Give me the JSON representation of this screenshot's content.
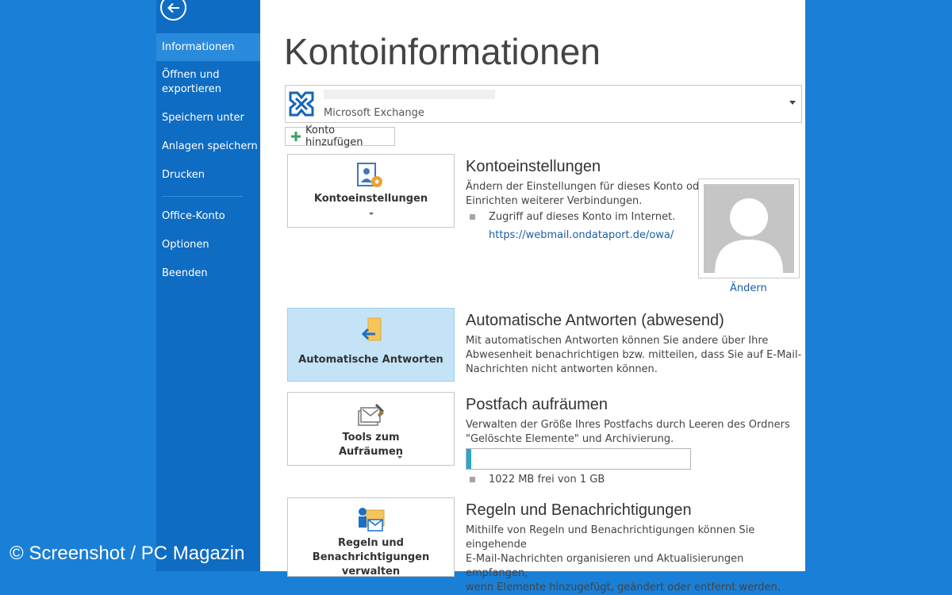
{
  "sidebar": {
    "back_icon": "back-arrow-icon",
    "items": [
      {
        "label": "Informationen",
        "active": true
      },
      {
        "label": "Öffnen und exportieren"
      },
      {
        "label": "Speichern unter"
      },
      {
        "label": "Anlagen speichern"
      },
      {
        "label": "Drucken"
      },
      {
        "label": "Office-Konto"
      },
      {
        "label": "Optionen"
      },
      {
        "label": "Beenden"
      }
    ]
  },
  "main": {
    "title": "Kontoinformationen",
    "account": {
      "type": "Microsoft Exchange",
      "icon": "exchange-icon"
    },
    "add_account_label": "Konto hinzufügen",
    "sections": {
      "account_settings": {
        "tile_label": "Kontoeinstellungen",
        "title": "Kontoeinstellungen",
        "description": "Ändern der Einstellungen für dieses Konto oder\nEinrichten weiterer Verbindungen.",
        "bullet": "Zugriff auf dieses Konto im Internet.",
        "link": "https://webmail.ondataport.de/owa/",
        "change_photo_label": "Ändern"
      },
      "auto_replies": {
        "tile_label": "Automatische Antworten",
        "title": "Automatische Antworten (abwesend)",
        "description": "Mit automatischen Antworten können Sie andere über Ihre\nAbwesenheit benachrichtigen bzw. mitteilen, dass Sie auf E-Mail-\nNachrichten nicht antworten können."
      },
      "cleanup": {
        "tile_label": "Tools zum Aufräumen",
        "title": "Postfach aufräumen",
        "description": "Verwalten der Größe Ihres Postfachs durch Leeren des Ordners\n\"Gelöschte Elemente\" und Archivierung.",
        "quota_text": "1022 MB frei von 1 GB",
        "quota_used_fraction": 0.02
      },
      "rules": {
        "tile_label": "Regeln und Benachrichtigungen verwalten",
        "title": "Regeln und Benachrichtigungen",
        "description": "Mithilfe von Regeln und Benachrichtigungen können Sie eingehende\nE-Mail-Nachrichten organisieren und Aktualisierungen empfangen,\nwenn Elemente hinzugefügt, geändert oder entfernt werden."
      }
    }
  },
  "watermark": "© Screenshot / PC Magazin",
  "colors": {
    "background": "#1a7fd6",
    "sidebar": "#0f6cc3",
    "accent": "#2ba7c7",
    "link": "#1b5ea3"
  }
}
